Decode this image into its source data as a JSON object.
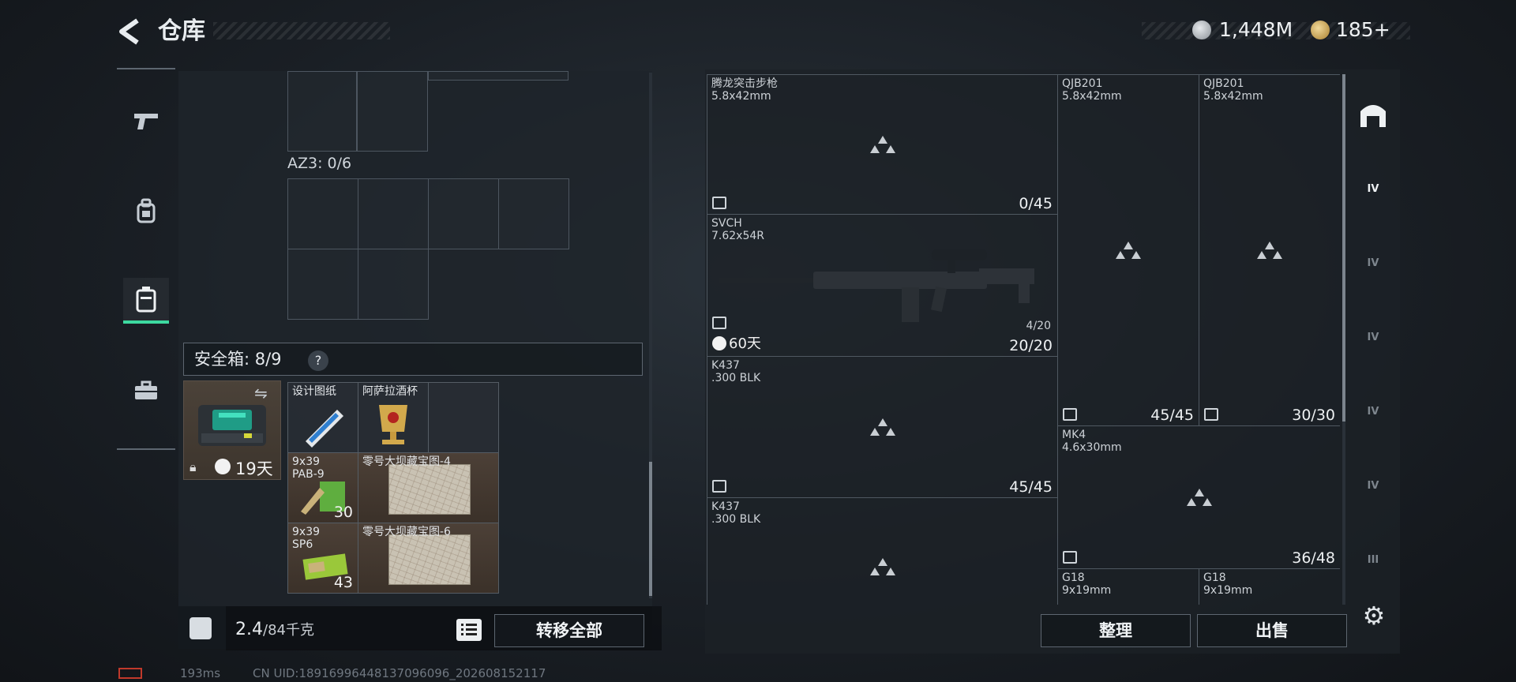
{
  "header": {
    "title": "仓库",
    "silver": "1,448M",
    "gold": "185+"
  },
  "left": {
    "az3_label": "AZ3: 0/6",
    "safe_label": "安全箱: 8/9",
    "safe_help": "?",
    "safebox_timer": "19天",
    "items": [
      {
        "name": "设计图纸",
        "count": ""
      },
      {
        "name": "阿萨拉酒杯",
        "count": ""
      },
      {
        "name": "9x39\nPAB-9",
        "count": "30"
      },
      {
        "name": "零号大坝藏宝图-4",
        "count": ""
      },
      {
        "name": "9x39\nSP6",
        "count": "43"
      },
      {
        "name": "零号大坝藏宝图-6",
        "count": ""
      }
    ],
    "weight_value": "2.4",
    "weight_unit": "/84千克",
    "transfer_all": "转移全部"
  },
  "right": {
    "tiles": [
      {
        "name": "腾龙突击步枪\n5.8x42mm",
        "ammo": "0/45",
        "sub": "",
        "timer": ""
      },
      {
        "name": "QJB201\n5.8x42mm",
        "ammo": "45/45",
        "sub": "",
        "timer": ""
      },
      {
        "name": "QJB201\n5.8x42mm",
        "ammo": "30/30",
        "sub": "",
        "timer": ""
      },
      {
        "name": "SVCH\n7.62x54R",
        "ammo": "20/20",
        "sub": "4/20",
        "timer": "60天"
      },
      {
        "name": "K437\n.300 BLK",
        "ammo": "45/45",
        "sub": "",
        "timer": ""
      },
      {
        "name": "MK4\n4.6x30mm",
        "ammo": "36/48",
        "sub": "",
        "timer": ""
      },
      {
        "name": "K437\n.300 BLK",
        "ammo": "",
        "sub": "",
        "timer": ""
      },
      {
        "name": "G18\n9x19mm",
        "ammo": "",
        "sub": "",
        "timer": ""
      },
      {
        "name": "G18\n9x19mm",
        "ammo": "",
        "sub": "",
        "timer": ""
      }
    ],
    "sort_label": "整理",
    "sell_label": "出售",
    "filter_tiers": [
      "IV",
      "IV",
      "IV",
      "IV",
      "IV",
      "III"
    ]
  },
  "footer": {
    "ping": "193ms",
    "uid": "CN UID:18916996448137096096_202608152117"
  },
  "colors": {
    "accent": "#3dd9a0",
    "panel": "#1e242b",
    "border": "#4f5861"
  }
}
